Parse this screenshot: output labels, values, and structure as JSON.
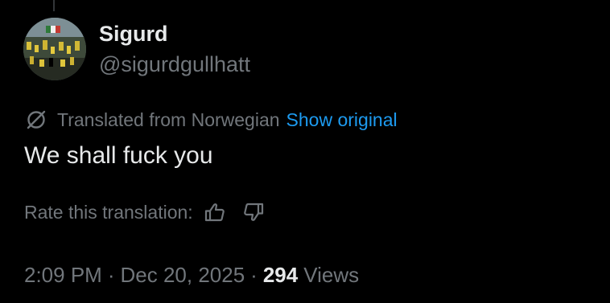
{
  "author": {
    "display_name": "Sigurd",
    "handle": "@sigurdgullhatt"
  },
  "translation": {
    "icon": "translate-icon",
    "notice": "Translated from Norwegian",
    "show_original_label": "Show original"
  },
  "tweet": {
    "text": "We shall fuck you"
  },
  "rating": {
    "label": "Rate this translation:",
    "up_icon": "thumbs-up-icon",
    "down_icon": "thumbs-down-icon"
  },
  "meta": {
    "time": "2:09 PM",
    "separator": "·",
    "date": "Dec 20, 2025",
    "views_count": "294",
    "views_label": "Views"
  },
  "colors": {
    "background": "#000000",
    "primary_text": "#e7e9ea",
    "secondary_text": "#71767b",
    "link": "#1d9bf0"
  }
}
